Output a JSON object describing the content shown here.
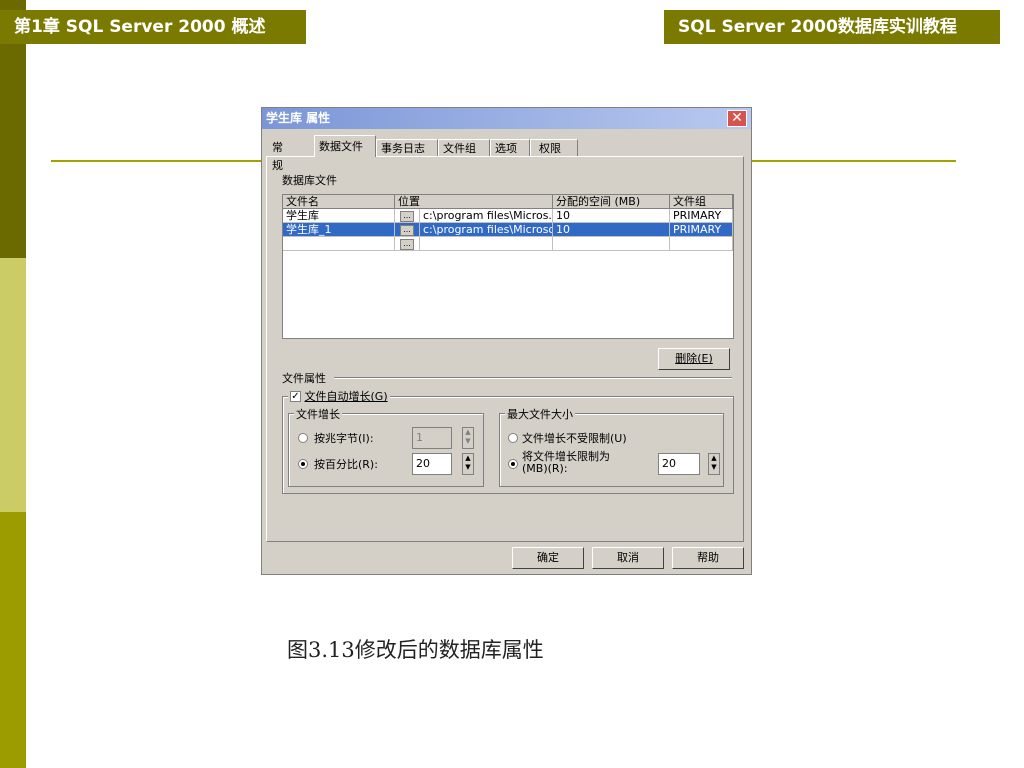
{
  "slide": {
    "header_left": "第1章  SQL Server 2000  概述",
    "header_right": "SQL Server 2000数据库实训教程",
    "caption": "图3.13修改后的数据库属性"
  },
  "dialog": {
    "title": "学生库 属性",
    "close_glyph": "✕",
    "tabs": [
      "常规",
      "数据文件",
      "事务日志",
      "文件组",
      "选项",
      "权限"
    ],
    "active_tab": "数据文件",
    "section_label": "数据库文件",
    "table": {
      "headers": [
        "文件名",
        "位置",
        "分配的空间 (MB)",
        "文件组"
      ],
      "ellipsis": "...",
      "rows": [
        {
          "name": "学生库",
          "location": "c:\\program files\\Micros...",
          "size": "10",
          "filegroup": "PRIMARY"
        },
        {
          "name": "学生库_1",
          "location": "c:\\program files\\Microso...",
          "size": "10",
          "filegroup": "PRIMARY"
        }
      ]
    },
    "delete_button": "删除(E)",
    "file_props_label": "文件属性",
    "auto_grow_label": "文件自动增长(G)",
    "auto_grow_checked": true,
    "growth_group": "文件增长",
    "by_mb_label": "按兆字节(I):",
    "by_mb_value": "1",
    "by_percent_label": "按百分比(R):",
    "by_percent_value": "20",
    "growth_selected": "percent",
    "maxsize_group": "最大文件大小",
    "unlimited_label": "文件增长不受限制(U)",
    "limit_label_1": "将文件增长限制为",
    "limit_label_2": "(MB)(R):",
    "limit_value": "20",
    "maxsize_selected": "limit",
    "ok_button": "确定",
    "cancel_button": "取消",
    "help_button": "帮助"
  }
}
